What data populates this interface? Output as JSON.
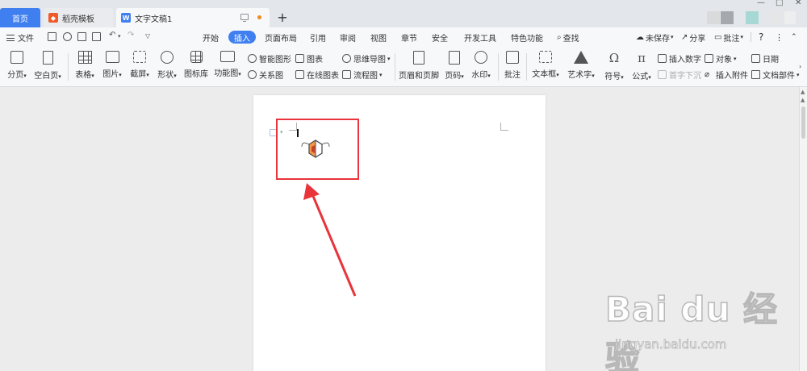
{
  "tabs": {
    "home": "首页",
    "template": "稻壳模板",
    "document": "文字文稿1",
    "new_tab": "+"
  },
  "menubar": {
    "file": "文件",
    "tabs": [
      "开始",
      "插入",
      "页面布局",
      "引用",
      "审阅",
      "视图",
      "章节",
      "安全",
      "开发工具",
      "特色功能"
    ],
    "active_tab": "插入",
    "search": "查找",
    "unsaved": "未保存",
    "share": "分享",
    "comment": "批注",
    "help": "?"
  },
  "ribbon": {
    "page_break": "分页",
    "blank_page": "空白页",
    "table": "表格",
    "picture": "图片",
    "screenshot": "截屏",
    "shape": "形状",
    "icon_lib": "图标库",
    "func_chart": "功能图",
    "smart_art": "智能图形",
    "chart": "图表",
    "mind_map": "思维导图",
    "relation": "关系图",
    "online_chart": "在线图表",
    "flowchart": "流程图",
    "header_footer": "页眉和页脚",
    "page_number": "页码",
    "watermark": "水印",
    "comment": "批注",
    "textbox": "文本框",
    "wordart": "艺术字",
    "symbol": "符号",
    "formula": "公式",
    "insert_number": "插入数字",
    "object": "对象",
    "date": "日期",
    "drop_cap": "首字下沉",
    "attachment": "插入附件",
    "doc_parts": "文档部件"
  },
  "watermark_text": {
    "logo": "Bai du 经验",
    "url": "jingyan.baidu.com"
  },
  "colors": {
    "accent": "#3f7ff0",
    "highlight": "#e8343a"
  }
}
